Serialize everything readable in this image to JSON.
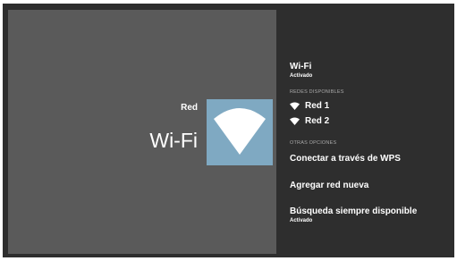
{
  "hero": {
    "subtitle": "Red",
    "title": "Wi-Fi",
    "tile_color": "#7fa9c2",
    "icon": "wifi-icon"
  },
  "menu": {
    "wifi": {
      "title": "Wi-Fi",
      "status": "Activado"
    },
    "available_header": "REDES DISPONIBLES",
    "networks": [
      {
        "label": "Red 1",
        "icon": "wifi-icon"
      },
      {
        "label": "Red 2",
        "icon": "wifi-icon"
      }
    ],
    "other_header": "OTRAS OPCIONES",
    "wps": {
      "title": "Conectar a través de WPS"
    },
    "add_network": {
      "title": "Agregar red nueva"
    },
    "always_scan": {
      "title": "Búsqueda siempre disponible",
      "status": "Activado"
    }
  }
}
